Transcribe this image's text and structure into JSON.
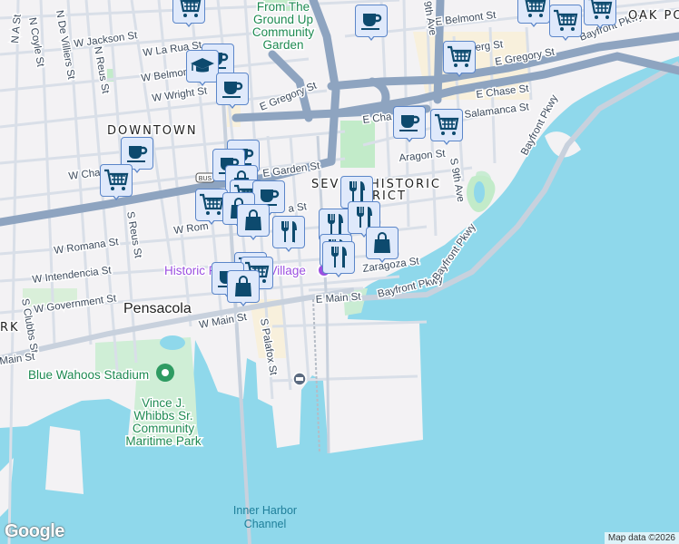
{
  "map": {
    "areas": {
      "downtown": "DOWNTOWN",
      "seville": "SEVILLE HISTORIC DISTRICT",
      "seville_line1": "SEVI",
      "seville_line1b": "HISTORIC",
      "seville_line2": "RICT",
      "oak_park": "OAK PO",
      "park_cut": "RK"
    },
    "city": "Pensacola",
    "streets": {
      "n_a": "N A St",
      "n_coyle": "N Coyle St",
      "n_de_villiers": "N De Villiers St",
      "n_reus": "N Reus St",
      "w_jackson": "W Jackson St",
      "w_la_rua": "W La Rua St",
      "w_belmont": "W Belmon",
      "w_wright": "W Wright St",
      "e_gregory": "E Gregory St",
      "e_gregory2": "E Gregory St",
      "e_chase": "E Chase St",
      "e_chase_cut": "E Cha",
      "w_chase": "W Cha",
      "e_garden": "E Garden St",
      "w_romana": "W Romana St",
      "w_romana_cut": "W Rom",
      "s_reus": "S Reus St",
      "w_intendencia": "W Intendencia St",
      "w_government": "W Government St",
      "s_clubbs": "S Clubbs St",
      "w_main": "W Main St",
      "main_cut": "Main St",
      "e_main": "E Main St",
      "s_palafox": "S Palafox St",
      "bayfront1": "Bayfront Pkwy",
      "bayfront2": "Bayfront Pkwy",
      "bayfront3": "Bayfront Pkwy",
      "e_belmont": "E Belmont St",
      "n_9th": "9th Ave",
      "s_9th": "S 9th Ave",
      "aragon": "Aragon St",
      "salamanca": "Salamanca St",
      "zaragoza": "Zaragoza St",
      "berg": "erg St",
      "romana_e": "a St"
    },
    "parks": {
      "garden": [
        "From The",
        "Ground Up",
        "Community",
        "Garden"
      ],
      "stadium": "Blue Wahoos Stadium",
      "maritime": [
        "Vince J.",
        "Whibbs Sr.",
        "Community",
        "Maritime Park"
      ]
    },
    "poi": {
      "historic_village": "Historic Pensacola Village"
    },
    "water": [
      "Inner Harbor",
      "Channel"
    ],
    "shield": "BUS",
    "markers_legend": {
      "coffee": "coffee-icon",
      "grocery": "shopping-cart-icon",
      "shopping": "shopping-bag-icon",
      "restaurant": "fork-knife-icon",
      "school": "graduation-cap-icon"
    }
  },
  "footer": {
    "logo": "Google",
    "attribution": "Map data ©2026"
  }
}
